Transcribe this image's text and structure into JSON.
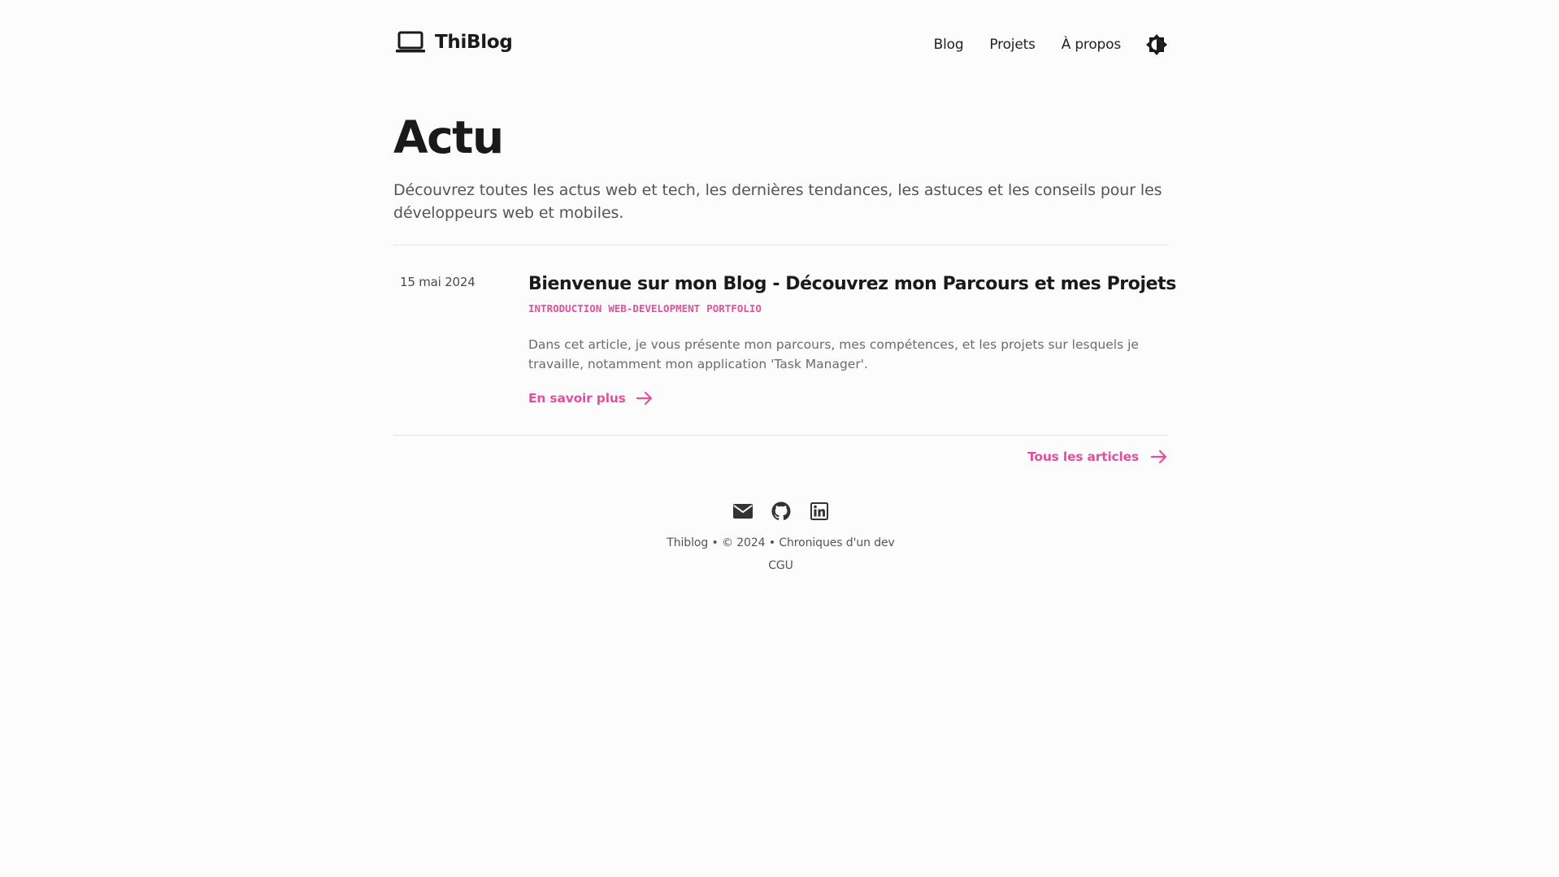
{
  "header": {
    "brand": "ThiBlog",
    "nav": [
      "Blog",
      "Projets",
      "À propos"
    ]
  },
  "hero": {
    "title": "Actu",
    "description": "Découvrez toutes les actus web et tech, les dernières tendances, les astuces et les conseils pour les développeurs web et mobiles."
  },
  "posts": [
    {
      "date": "15 mai 2024",
      "title": "Bienvenue sur mon Blog - Découvrez mon Parcours et mes Projets",
      "tags": [
        "INTRODUCTION",
        "WEB-DEVELOPMENT",
        "PORTFOLIO"
      ],
      "summary": "Dans cet article, je vous présente mon parcours, mes compétences, et les projets sur lesquels je travaille, notamment mon application 'Task Manager'.",
      "read_more": "En savoir plus"
    }
  ],
  "all_articles": "Tous les articles",
  "footer": {
    "icons": [
      "mail-icon",
      "github-icon",
      "linkedin-icon"
    ],
    "line": "Thiblog • © 2024 • Chroniques d'un dev",
    "terms": "CGU"
  },
  "colors": {
    "accent": "#e0509f",
    "text": "#1a1a1a",
    "muted": "#555555",
    "background": "#fdfcfc"
  }
}
